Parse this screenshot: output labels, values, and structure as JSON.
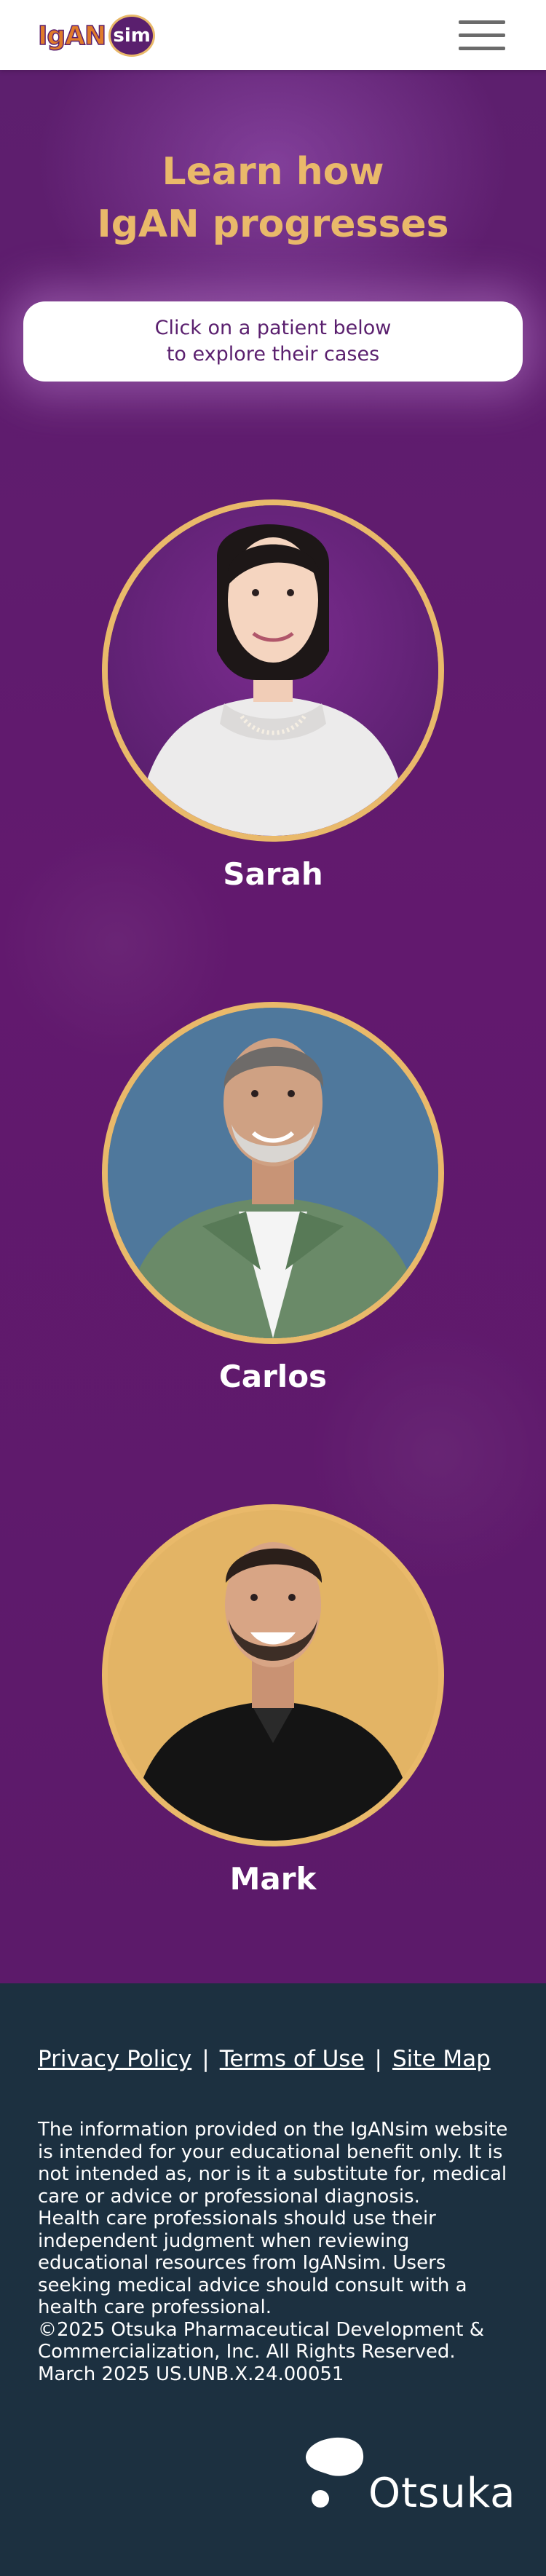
{
  "header": {
    "logo_word": "IgAN",
    "logo_badge": "sim",
    "menu_icon": "hamburger-menu-icon"
  },
  "hero": {
    "title_line1": "Learn how",
    "title_line2": "IgAN progresses",
    "instruction_line1": "Click on a patient below",
    "instruction_line2": "to explore their cases"
  },
  "patients": [
    {
      "name": "Sarah",
      "portrait_bg": "#5a1f6e"
    },
    {
      "name": "Carlos",
      "portrait_bg": "#4f789c"
    },
    {
      "name": "Mark",
      "portrait_bg": "#e3b465"
    }
  ],
  "footer": {
    "links": [
      "Privacy Policy",
      "Terms of Use",
      "Site Map"
    ],
    "separator": "|",
    "disclaimer": [
      "The information provided on the IgANsim website is intended for your educational benefit only. It is not intended as, nor is it a substitute for, medical care or advice or professional diagnosis.",
      "Health care professionals should use their independent judgment when reviewing educational resources from IgANsim. Users seeking medical advice should consult with a health care professional.",
      "©2025 Otsuka Pharmaceutical Development & Commercialization, Inc. All Rights Reserved.",
      "March 2025 US.UNB.X.24.00051"
    ],
    "brand_name": "Otsuka"
  },
  "colors": {
    "brand_purple": "#5a1f6e",
    "gold": "#e9b96a",
    "footer_navy": "#1c3040"
  }
}
